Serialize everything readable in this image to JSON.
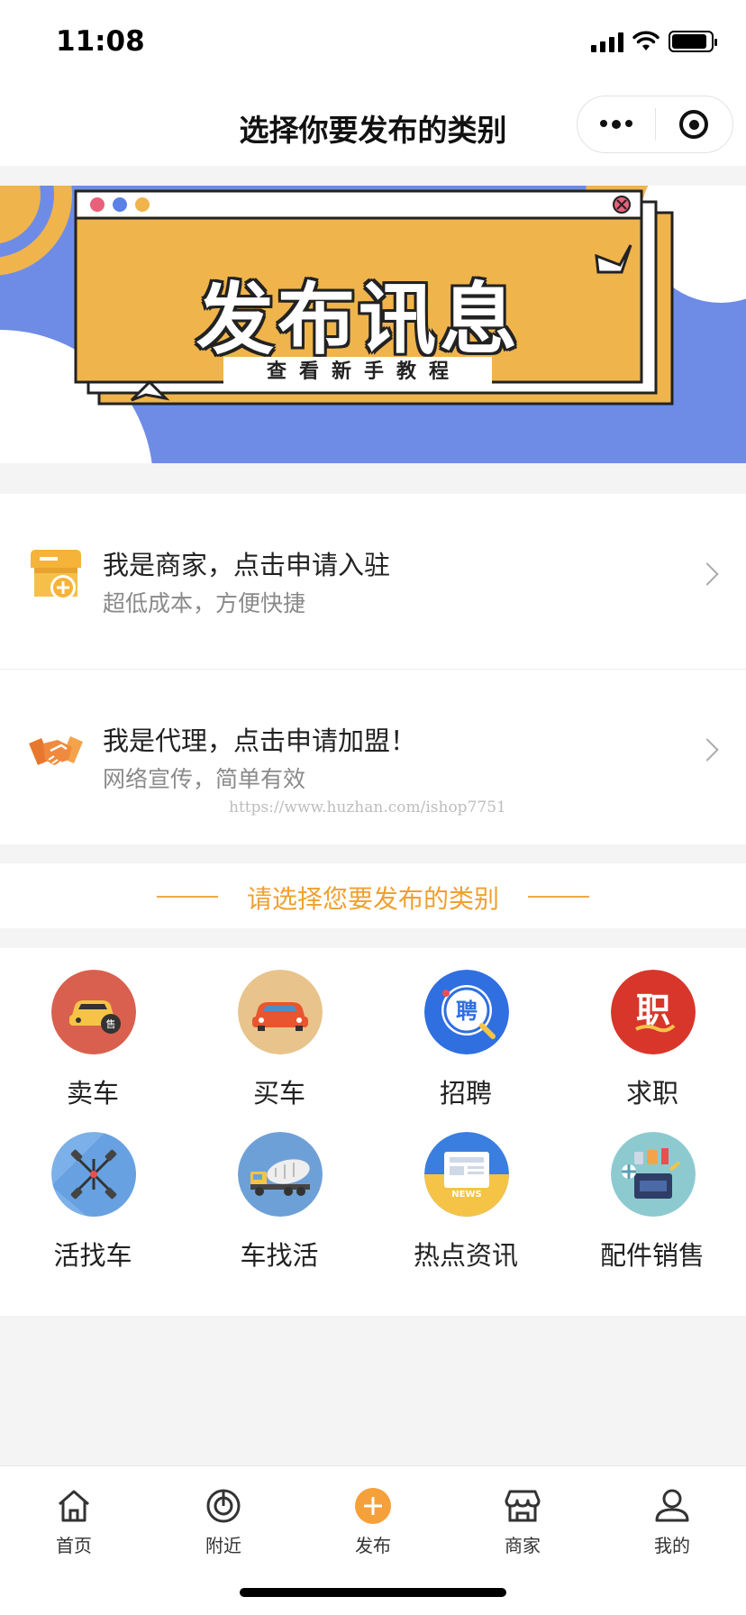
{
  "status_bar": {
    "time": "11:08",
    "battery_level": 0.9
  },
  "nav": {
    "title": "选择你要发布的类别",
    "menu_icon": "more-dots-icon",
    "close_icon": "target-circle-icon"
  },
  "banner": {
    "title": "发布讯息",
    "subtitle": "查看新手教程"
  },
  "join": [
    {
      "title": "我是商家，点击申请入驻",
      "subtitle": "超低成本，方便快捷",
      "icon": "shop-plus-icon"
    },
    {
      "title": "我是代理，点击申请加盟！",
      "subtitle": "网络宣传，简单有效",
      "icon": "handshake-icon"
    }
  ],
  "watermark": "https://www.huzhan.com/ishop7751",
  "section": {
    "title": "请选择您要发布的类别"
  },
  "categories": [
    {
      "label": "卖车",
      "icon": "sell-car-icon"
    },
    {
      "label": "买车",
      "icon": "buy-car-icon"
    },
    {
      "label": "招聘",
      "icon": "recruit-icon",
      "glyph": "聘"
    },
    {
      "label": "求职",
      "icon": "job-seek-icon",
      "glyph": "职"
    },
    {
      "label": "活找车",
      "icon": "chassis-icon"
    },
    {
      "label": "车找活",
      "icon": "mixer-truck-icon"
    },
    {
      "label": "热点资讯",
      "icon": "news-icon",
      "glyph": "NEWS"
    },
    {
      "label": "配件销售",
      "icon": "parts-icon"
    }
  ],
  "tabs": [
    {
      "label": "首页",
      "icon": "home-icon"
    },
    {
      "label": "附近",
      "icon": "nearby-icon"
    },
    {
      "label": "发布",
      "icon": "publish-plus-icon"
    },
    {
      "label": "商家",
      "icon": "store-icon"
    },
    {
      "label": "我的",
      "icon": "profile-icon"
    }
  ],
  "colors": {
    "accent": "#f0a030",
    "banner_blue": "#6e8ce6",
    "banner_yellow": "#f0b44c"
  }
}
